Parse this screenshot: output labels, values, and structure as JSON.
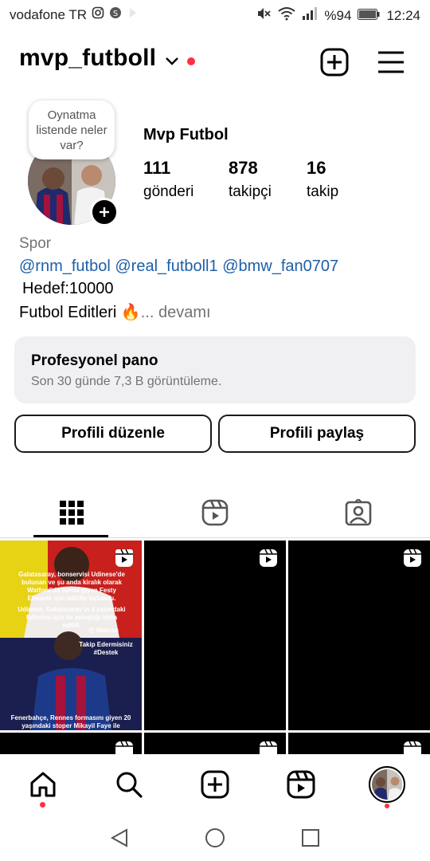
{
  "status_bar": {
    "carrier": "vodafone TR",
    "battery": "%94",
    "time": "12:24"
  },
  "header": {
    "username": "mvp_futboll"
  },
  "profile": {
    "note": "Oynatma listende neler var?",
    "display_name": "Mvp Futbol",
    "stats": [
      {
        "value": "111",
        "label": "gönderi"
      },
      {
        "value": "878",
        "label": "takipçi"
      },
      {
        "value": "16",
        "label": "takip"
      }
    ],
    "category": "Spor",
    "mentions": [
      "@rnm_futbol",
      "@real_futboll1",
      "@bmw_fan0707"
    ],
    "bio_line1": "Hedef:10000",
    "bio_line2": "Futbol Editleri 🔥",
    "more": "... devamı"
  },
  "dashboard": {
    "title": "Profesyonel pano",
    "subtitle": "Son 30 günde 7,3 B görüntüleme."
  },
  "buttons": {
    "edit_profile": "Profili düzenle",
    "share_profile": "Profili paylaş"
  },
  "grid": {
    "post1_caption_top": "Galatasaray, bonservisi Udinese'de bulunan ve şu anda kiralık olarak Watford'da forma giyen Festy Ebosele için teklifte bulundu.",
    "post1_caption_mid": "Udinese, Galatasaray'ın 4 yaşındaki futbolcu için ile anlaştığı iddia edildi.",
    "post1_handle": "@ Marcos",
    "post1_tag": "Takip Edermisiniz #Destek",
    "post1_caption_bottom": "Fenerbahçe, Rennes formasını giyen 20 yaşındaki stoper Mikayil Faye ile ilgileniyor."
  }
}
